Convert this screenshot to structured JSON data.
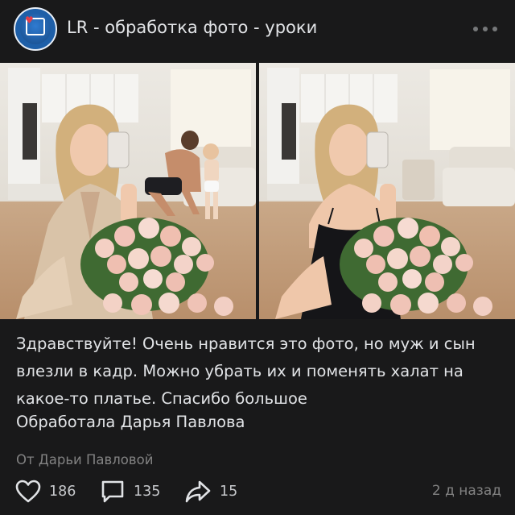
{
  "group": {
    "name": "LR -  обработка фото - уроки",
    "avatar_icon": "heart-camera-logo"
  },
  "photos": [
    {
      "label": "original photo"
    },
    {
      "label": "edited photo"
    }
  ],
  "post": {
    "text": "Здравствуйте! Очень нравится это фото, но муж и сын влезли в кадр. Можно убрать их и поменять халат на какое-то платье. Спасибо большое",
    "author_line": "Обработала Дарья Павлова",
    "signed": "От Дарьи Павловой"
  },
  "actions": {
    "likes": "186",
    "comments": "135",
    "shares": "15",
    "time": "2 д назад"
  },
  "colors": {
    "background": "#19191a",
    "text": "#e1e3e6",
    "secondary": "#828282"
  }
}
